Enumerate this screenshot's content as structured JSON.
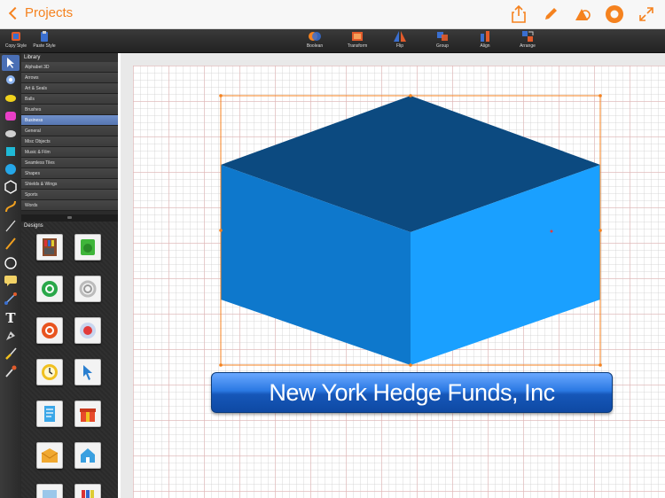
{
  "nav": {
    "back_label": "Projects",
    "icons": [
      "share-icon",
      "pencil-icon",
      "shapes-icon",
      "settings-icon",
      "fullscreen-icon"
    ],
    "accent": "#f5821f"
  },
  "toolbar": {
    "copy_style": "Copy Style",
    "paste_style": "Paste Style",
    "boolean": "Boolean",
    "transform": "Transform",
    "flip": "Flip",
    "group": "Group",
    "align": "Align",
    "arrange": "Arrange"
  },
  "library": {
    "title": "Library",
    "items": [
      "Alphabet 3D",
      "Arrows",
      "Art & Seals",
      "Balls",
      "Brushes",
      "Business",
      "General",
      "Misc Objects",
      "Music & Film",
      "Seamless Tiles",
      "Shapes",
      "Shields & Wings",
      "Sports",
      "Words"
    ],
    "selected": "Business"
  },
  "designs": {
    "title": "Designs"
  },
  "canvas": {
    "banner_text": "New York Hedge Funds, Inc",
    "cube_colors": {
      "top": "#0c4a80",
      "left": "#0e78cc",
      "right": "#1aa0ff"
    }
  }
}
